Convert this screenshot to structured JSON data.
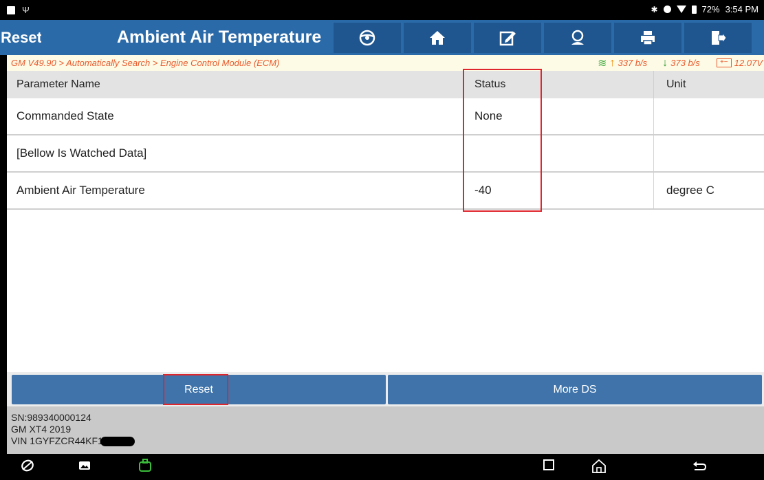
{
  "toolbar": {
    "left_fragment": "Reset",
    "title": "Ambient Air Temperature",
    "icons": [
      "steering-wheel-icon",
      "home-icon",
      "edit-icon",
      "user-support-icon",
      "print-icon",
      "exit-icon"
    ]
  },
  "statusbar": {
    "battery": "72%",
    "time": "3:54 PM"
  },
  "breadcrumb": {
    "path": "GM V49.90 > Automatically Search > Engine Control Module (ECM)",
    "upload_rate": "337 b/s",
    "download_rate": "373 b/s",
    "voltage": "12.07V"
  },
  "table": {
    "headers": [
      "Parameter Name",
      "Status",
      "Unit"
    ],
    "rows": [
      {
        "name": "Commanded State",
        "status": "None",
        "unit": ""
      },
      {
        "name": "[Bellow Is Watched Data]",
        "status": "",
        "unit": ""
      },
      {
        "name": "Ambient Air Temperature",
        "status": "-40",
        "unit": "degree C"
      }
    ]
  },
  "buttons": {
    "reset": "Reset",
    "more_ds": "More DS"
  },
  "info": {
    "sn": "SN:989340000124",
    "vehicle": "GM XT4 2019",
    "vin": "VIN 1GYFZCR44KF1"
  },
  "colors": {
    "toolbar": "#2b6aa8",
    "button": "#3f73aa",
    "annotation": "#e0262d",
    "breadcrumb_text": "#e95a2c"
  }
}
